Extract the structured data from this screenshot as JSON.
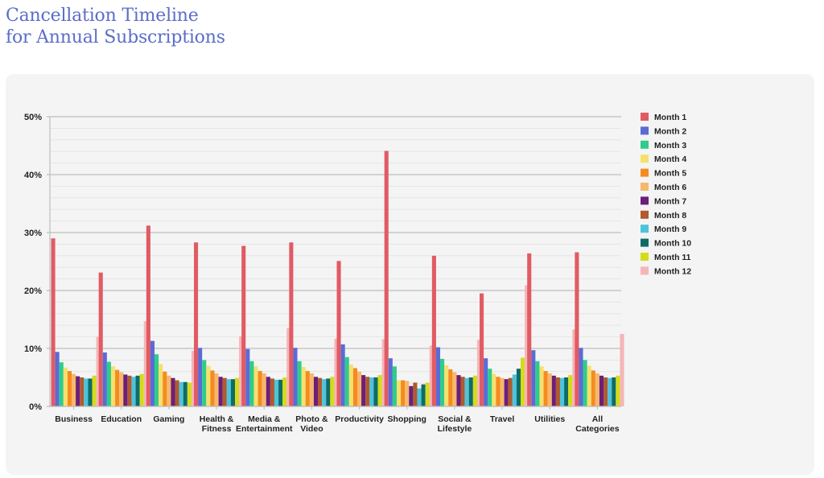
{
  "page": {
    "title_line1": "Cancellation Timeline",
    "title_line2": "for Annual Subscriptions"
  },
  "chart_data": {
    "type": "bar",
    "title": "Cancellation Timeline for Annual Subscriptions",
    "xlabel": "",
    "ylabel": "",
    "ylim": [
      0,
      50
    ],
    "yticks": [
      0,
      10,
      20,
      30,
      40,
      50
    ],
    "ytick_labels": [
      "0%",
      "10%",
      "20%",
      "30%",
      "40%",
      "50%"
    ],
    "grid": true,
    "legend_position": "right",
    "categories": [
      [
        "Business"
      ],
      [
        "Education"
      ],
      [
        "Gaming"
      ],
      [
        "Health &",
        "Fitness"
      ],
      [
        "Media &",
        "Entertainment"
      ],
      [
        "Photo &",
        "Video"
      ],
      [
        "Productivity"
      ],
      [
        "Shopping"
      ],
      [
        "Social &",
        "Lifestyle"
      ],
      [
        "Travel"
      ],
      [
        "Utilities"
      ],
      [
        "All",
        "Categories"
      ]
    ],
    "series": [
      {
        "name": "Month 1",
        "color": "#e15b64",
        "values": [
          29.0,
          23.1,
          31.2,
          28.3,
          27.7,
          28.3,
          25.1,
          44.1,
          26.0,
          19.5,
          26.4,
          26.6
        ]
      },
      {
        "name": "Month 2",
        "color": "#5b6bd6",
        "values": [
          9.4,
          9.3,
          11.3,
          10.1,
          9.9,
          10.1,
          10.7,
          8.3,
          10.2,
          8.3,
          9.7,
          10.1
        ]
      },
      {
        "name": "Month 3",
        "color": "#2ecc8a",
        "values": [
          7.6,
          7.7,
          9.0,
          8.0,
          7.8,
          7.8,
          8.5,
          6.9,
          8.2,
          6.5,
          7.8,
          8.0
        ]
      },
      {
        "name": "Month 4",
        "color": "#f5e06e",
        "values": [
          6.7,
          6.9,
          7.3,
          7.0,
          6.9,
          6.8,
          7.2,
          4.5,
          7.1,
          5.6,
          6.9,
          7.0
        ]
      },
      {
        "name": "Month 5",
        "color": "#f58b1f",
        "values": [
          6.1,
          6.3,
          6.0,
          6.2,
          6.1,
          6.1,
          6.6,
          4.5,
          6.4,
          5.1,
          6.1,
          6.2
        ]
      },
      {
        "name": "Month 6",
        "color": "#f6b86b",
        "values": [
          5.6,
          5.9,
          5.3,
          5.7,
          5.7,
          5.7,
          6.0,
          4.4,
          5.9,
          4.9,
          5.7,
          5.7
        ]
      },
      {
        "name": "Month 7",
        "color": "#6b1f7a",
        "values": [
          5.2,
          5.5,
          4.9,
          5.1,
          5.1,
          5.1,
          5.4,
          3.5,
          5.4,
          4.7,
          5.3,
          5.3
        ]
      },
      {
        "name": "Month 8",
        "color": "#b05a2e",
        "values": [
          5.0,
          5.3,
          4.5,
          4.9,
          4.8,
          4.9,
          5.1,
          4.1,
          5.1,
          4.9,
          5.0,
          5.0
        ]
      },
      {
        "name": "Month 9",
        "color": "#4fc3dc",
        "values": [
          4.8,
          5.1,
          4.2,
          4.7,
          4.6,
          4.7,
          5.0,
          3.1,
          4.9,
          5.5,
          4.9,
          4.9
        ]
      },
      {
        "name": "Month 10",
        "color": "#0e6b68",
        "values": [
          4.8,
          5.3,
          4.2,
          4.7,
          4.6,
          4.8,
          5.0,
          3.8,
          5.0,
          6.5,
          5.0,
          5.0
        ]
      },
      {
        "name": "Month 11",
        "color": "#d4dc1a",
        "values": [
          5.3,
          5.6,
          4.1,
          4.9,
          5.0,
          5.1,
          5.4,
          4.1,
          5.3,
          8.4,
          5.4,
          5.3
        ]
      },
      {
        "name": "Month 12",
        "color": "#f4b6b8",
        "values": [
          12.0,
          14.7,
          9.6,
          12.1,
          13.5,
          11.7,
          11.6,
          10.5,
          11.5,
          20.9,
          13.3,
          12.5
        ]
      }
    ]
  }
}
